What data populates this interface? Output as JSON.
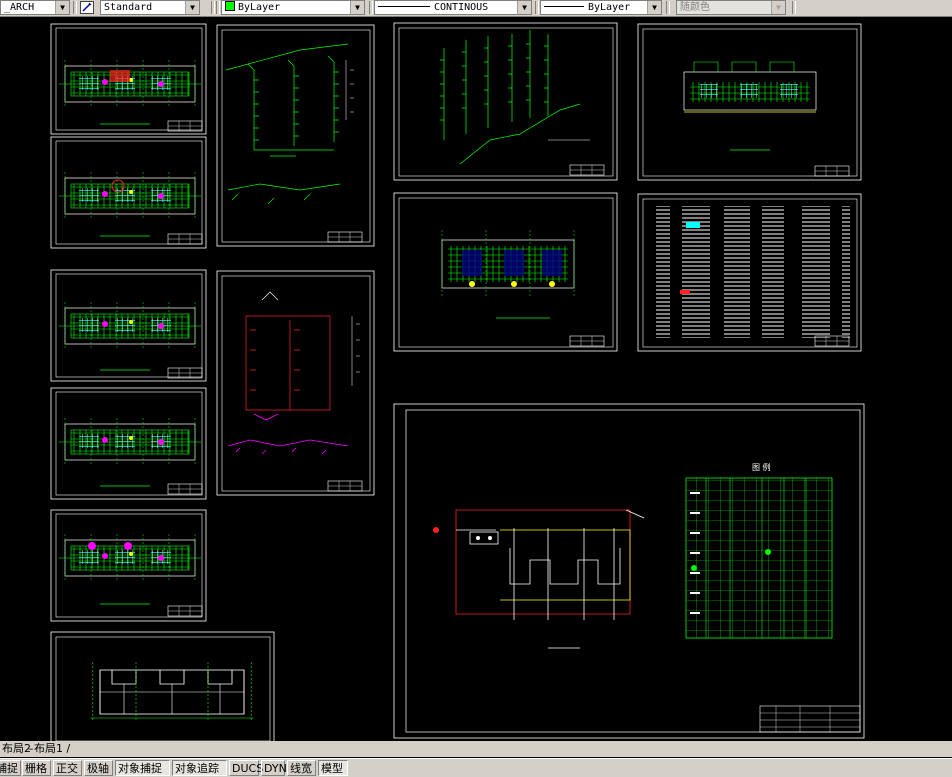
{
  "toolbar": {
    "layer": "_ARCH",
    "textstyle": "Standard",
    "color": "ByLayer",
    "color_swatch": "#00ff00",
    "linetype": "CONTINOUS",
    "lineweight": "ByLayer",
    "plotstyle": "随颜色"
  },
  "tabs": {
    "layout_tabs": "布局2",
    "layout_tab1": "布局1"
  },
  "status": {
    "snap": "捕捉",
    "grid": "栅格",
    "ortho": "正交",
    "polar": "极轴",
    "osnap": "对象捕捉",
    "otrack": "对象追踪",
    "ducs": "DUCS",
    "dyn": "DYN",
    "lwt": "线宽",
    "model": "模型"
  },
  "drawing": {
    "legend_title": "图 例",
    "colors": {
      "frame": "#ffffff",
      "green": "#00ff00",
      "cyan": "#00ffff",
      "red": "#ff2020",
      "yellow": "#ffff00",
      "magenta": "#ff00ff"
    }
  }
}
